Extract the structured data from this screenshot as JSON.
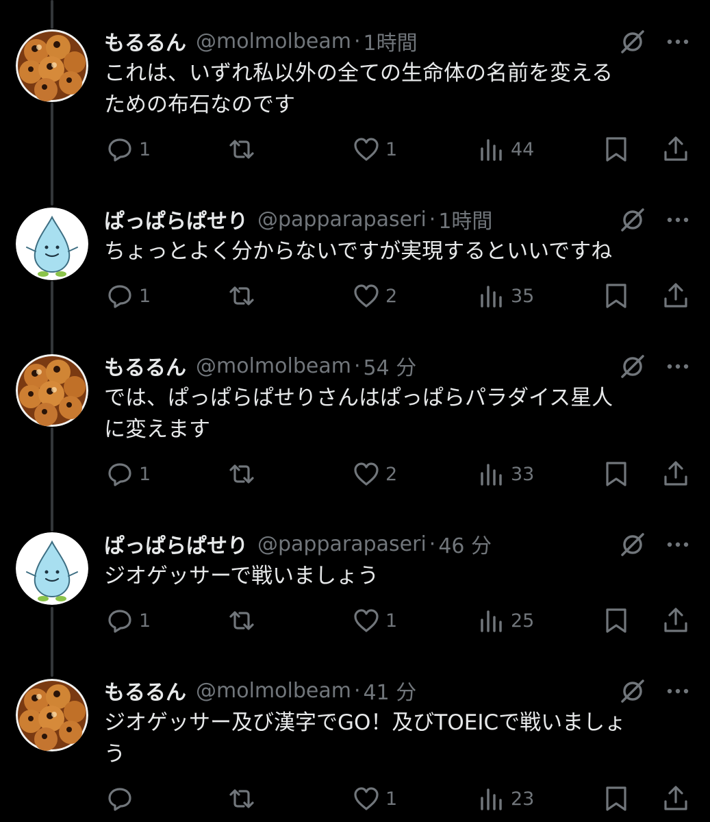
{
  "posts": [
    {
      "author": "もるるん",
      "handle": "@molmolbeam",
      "time": "1時間",
      "avatar_icon": "takoyaki-avatar",
      "text": "これは、いずれ私以外の全ての生命体の名前を変える\nための布石なのです",
      "replies": "1",
      "reposts": "",
      "likes": "1",
      "views": "44"
    },
    {
      "author": "ぱっぱらぱせり",
      "handle": "@papparapaseri",
      "time": "1時間",
      "avatar_icon": "water-drop-avatar",
      "text": "ちょっとよく分からないですが実現するといいですね",
      "replies": "1",
      "reposts": "",
      "likes": "2",
      "views": "35"
    },
    {
      "author": "もるるん",
      "handle": "@molmolbeam",
      "time": "54 分",
      "avatar_icon": "takoyaki-avatar",
      "text": "では、ぱっぱらぱせりさんはぱっぱらパラダイス星人\nに変えます",
      "replies": "1",
      "reposts": "",
      "likes": "2",
      "views": "33"
    },
    {
      "author": "ぱっぱらぱせり",
      "handle": "@papparapaseri",
      "time": "46 分",
      "avatar_icon": "water-drop-avatar",
      "text": "ジオゲッサーで戦いましょう",
      "replies": "1",
      "reposts": "",
      "likes": "1",
      "views": "25"
    },
    {
      "author": "もるるん",
      "handle": "@molmolbeam",
      "time": "41 分",
      "avatar_icon": "takoyaki-avatar",
      "text": "ジオゲッサー及び漢字でGO！及びTOEICで戦いましょ\nう",
      "replies": "",
      "reposts": "",
      "likes": "1",
      "views": "23"
    }
  ],
  "colors": {
    "background": "#000000",
    "text": "#e7e9ea",
    "muted": "#71767b",
    "thread_line": "#333639"
  }
}
